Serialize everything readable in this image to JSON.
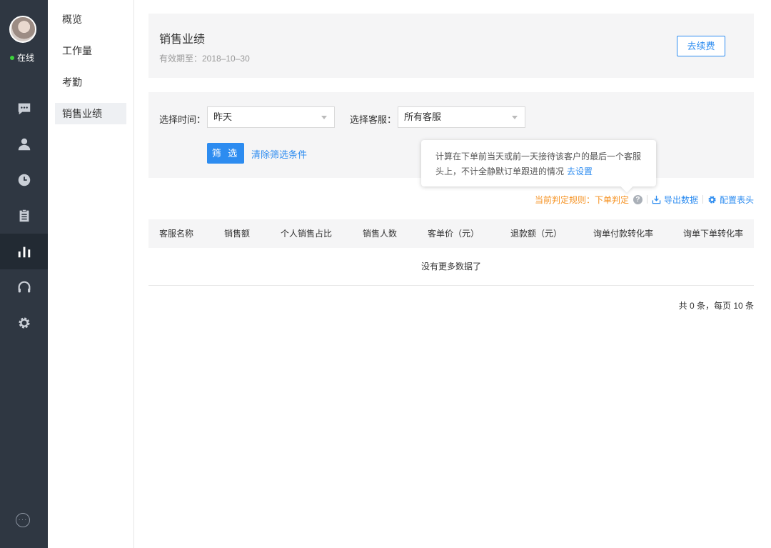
{
  "user": {
    "status": "在线"
  },
  "rail_icons": [
    "chat-icon",
    "user-icon",
    "clock-icon",
    "clipboard-icon",
    "bar-chart-icon",
    "headset-icon",
    "gear-icon"
  ],
  "submenu": [
    {
      "label": "概览"
    },
    {
      "label": "工作量"
    },
    {
      "label": "考勤"
    },
    {
      "label": "销售业绩"
    }
  ],
  "header": {
    "title": "销售业绩",
    "validity": "有效期至：2018–10–30",
    "renew_label": "去续费"
  },
  "filters": {
    "time_label": "选择时间：",
    "time_value": "昨天",
    "agent_label": "选择客服：",
    "agent_value": "所有客服",
    "filter_label": "筛 选",
    "clear_label": "清除筛选条件"
  },
  "tooltip": {
    "text": "计算在下单前当天或前一天接待该客户的最后一个客服头上，不计全静默订单跟进的情况",
    "link": "去设置"
  },
  "toolbar": {
    "rule": "当前判定规则：下单判定",
    "export": "导出数据",
    "config": "配置表头"
  },
  "table": {
    "columns": [
      "客服名称",
      "销售额",
      "个人销售占比",
      "销售人数",
      "客单价（元）",
      "退款额（元）",
      "询单付款转化率",
      "询单下单转化率"
    ],
    "empty_text": "没有更多数据了"
  },
  "pager": {
    "summary": "共 0 条，每页 10 条"
  },
  "colors": {
    "accent": "#2d8cf0",
    "rule": "#f5901e",
    "rail": "#2f3742",
    "online": "#3bd13b"
  }
}
